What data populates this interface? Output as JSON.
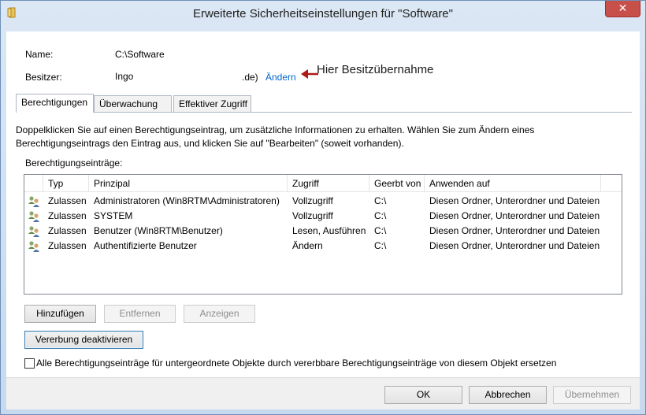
{
  "window": {
    "title": "Erweiterte Sicherheitseinstellungen für \"Software\"",
    "close_glyph": "✕"
  },
  "fields": {
    "name_label": "Name:",
    "name_value": "C:\\Software",
    "owner_label": "Besitzer:",
    "owner_value": "Ingo",
    "owner_suffix": ".de)",
    "owner_change_link": "Ändern"
  },
  "annotation": {
    "text": "Hier Besitzübernahme",
    "arrow_color": "#b01818"
  },
  "tabs": [
    {
      "label": "Berechtigungen",
      "active": true
    },
    {
      "label": "Überwachung",
      "active": false
    },
    {
      "label": "Effektiver Zugriff",
      "active": false
    }
  ],
  "permissions": {
    "description": "Doppelklicken Sie auf einen Berechtigungseintrag, um zusätzliche Informationen zu erhalten. Wählen Sie zum Ändern eines Berechtigungseintrags den Eintrag aus, und klicken Sie auf \"Bearbeiten\" (soweit vorhanden).",
    "entries_label": "Berechtigungseinträge:",
    "columns": [
      "Typ",
      "Prinzipal",
      "Zugriff",
      "Geerbt von",
      "Anwenden auf"
    ],
    "rows": [
      {
        "icon": "user-group-icon",
        "type": "Zulassen",
        "principal": "Administratoren (Win8RTM\\Administratoren)",
        "access": "Vollzugriff",
        "inherited": "C:\\",
        "applies": "Diesen Ordner, Unterordner und Dateien"
      },
      {
        "icon": "user-group-icon",
        "type": "Zulassen",
        "principal": "SYSTEM",
        "access": "Vollzugriff",
        "inherited": "C:\\",
        "applies": "Diesen Ordner, Unterordner und Dateien"
      },
      {
        "icon": "user-group-icon",
        "type": "Zulassen",
        "principal": "Benutzer (Win8RTM\\Benutzer)",
        "access": "Lesen, Ausführen",
        "inherited": "C:\\",
        "applies": "Diesen Ordner, Unterordner und Dateien"
      },
      {
        "icon": "user-group-icon",
        "type": "Zulassen",
        "principal": "Authentifizierte Benutzer",
        "access": "Ändern",
        "inherited": "C:\\",
        "applies": "Diesen Ordner, Unterordner und Dateien"
      }
    ]
  },
  "buttons": {
    "add": "Hinzufügen",
    "remove": "Entfernen",
    "view": "Anzeigen",
    "disable_inheritance": "Vererbung deaktivieren",
    "ok": "OK",
    "cancel": "Abbrechen",
    "apply": "Übernehmen"
  },
  "replace_checkbox": {
    "label": "Alle Berechtigungseinträge für untergeordnete Objekte durch vererbbare Berechtigungseinträge von diesem Objekt ersetzen",
    "checked": false
  }
}
